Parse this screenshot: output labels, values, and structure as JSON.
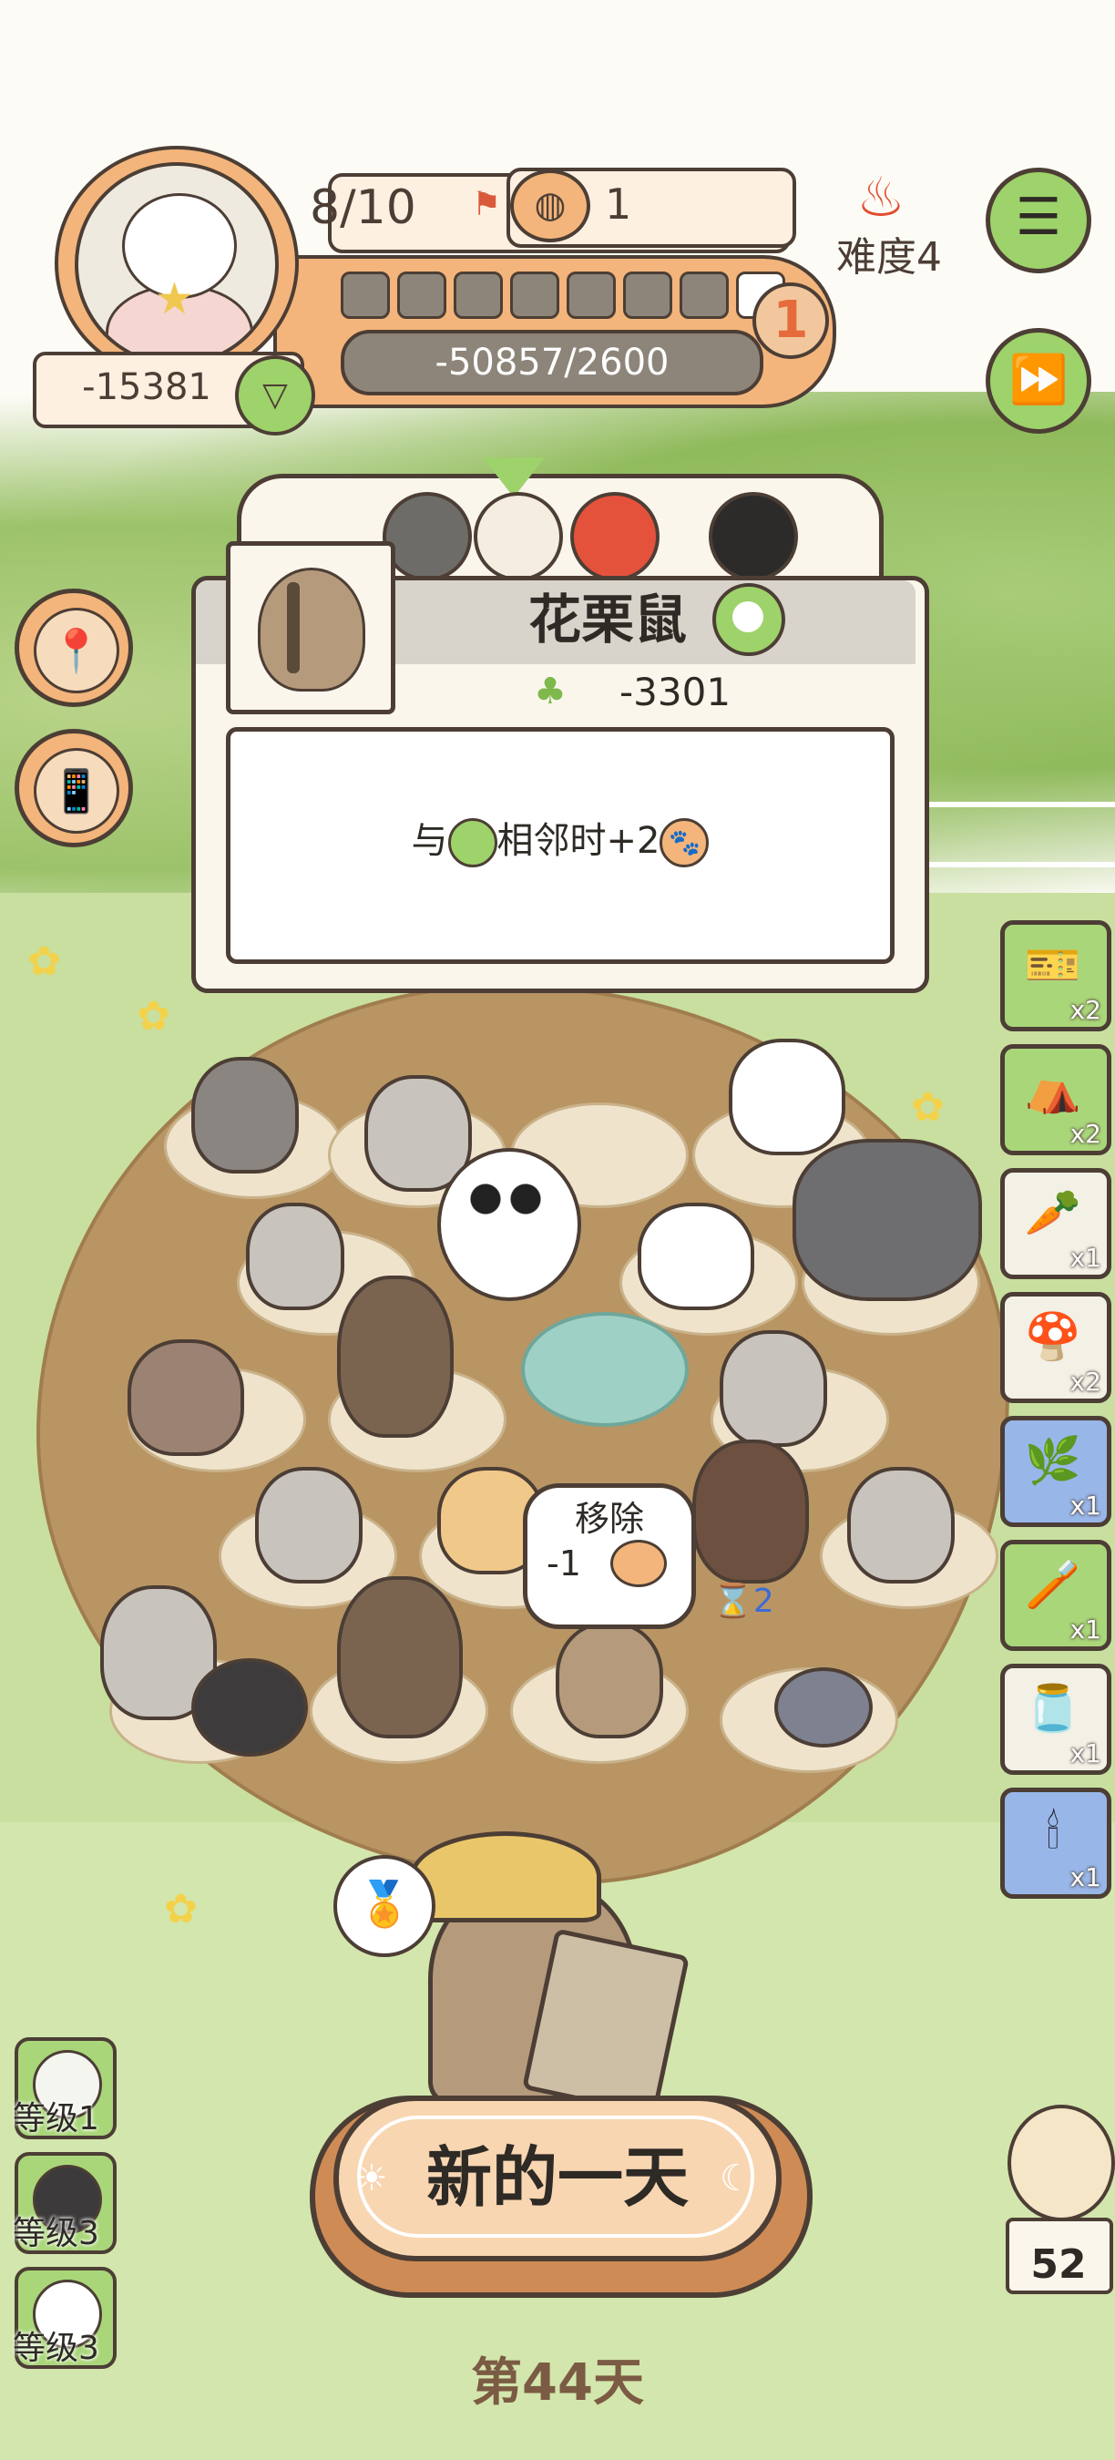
{
  "hud": {
    "animal_count": "8/10",
    "food_count": "1",
    "seeds": "-15381",
    "progress": "-50857/2600",
    "segments_total": 8,
    "segments_filled": 1,
    "level_badge": "1",
    "difficulty": "难度4",
    "icons": {
      "avatar": "angel-cat-avatar",
      "flag": "flag-icon",
      "food": "food-bowl-icon",
      "heart": "heart-icon",
      "difficulty": "flame-icon",
      "menu": "list-icon",
      "fast_forward": "fast-forward-icon"
    }
  },
  "popup": {
    "title": "花栗鼠",
    "cost": "-3301",
    "desc_prefix": "与",
    "desc_middle": "相邻时+2",
    "icons": {
      "portrait": "chipmunk-icon",
      "title_type": "green-token-icon",
      "cost": "seed-bag-icon",
      "paw": "paw-icon"
    }
  },
  "board": {
    "remove_title": "移除",
    "remove_value": "-1",
    "timer": "⌛2"
  },
  "inventory": [
    {
      "name": "ticket",
      "count": "x2",
      "color": "green",
      "icon": "🎫"
    },
    {
      "name": "tent",
      "count": "x2",
      "color": "green",
      "icon": "⛺"
    },
    {
      "name": "carrot",
      "count": "x1",
      "color": "plain",
      "icon": "🥕"
    },
    {
      "name": "mushroom",
      "count": "x2",
      "color": "plain",
      "icon": "🍄"
    },
    {
      "name": "seed-packet",
      "count": "x1",
      "color": "blue",
      "icon": "🌿"
    },
    {
      "name": "brush",
      "count": "x1",
      "color": "green",
      "icon": "🪥"
    },
    {
      "name": "jar",
      "count": "x1",
      "color": "plain",
      "icon": "🫙"
    },
    {
      "name": "candle-cake",
      "count": "x1",
      "color": "blue",
      "icon": "🕯"
    }
  ],
  "levels": [
    {
      "label": "等级1",
      "color": "#f5f5f0"
    },
    {
      "label": "等级3",
      "color": "#3c3a3a"
    },
    {
      "label": "等级3",
      "color": "#ffffff"
    }
  ],
  "new_day": "新的一天",
  "day": "第44天",
  "owl_count": "52"
}
